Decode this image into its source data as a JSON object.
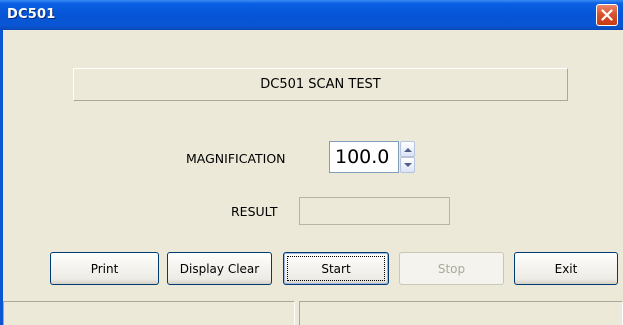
{
  "window": {
    "title": "DC501"
  },
  "banner": {
    "text": "DC501 SCAN TEST"
  },
  "magnification": {
    "label": "MAGNIFICATION",
    "value": "100.0"
  },
  "result": {
    "label": "RESULT",
    "value": ""
  },
  "buttons": {
    "print": "Print",
    "display_clear": "Display Clear",
    "start": "Start",
    "stop": "Stop",
    "exit": "Exit"
  },
  "status_bar": {
    "pane1": "",
    "pane2": ""
  },
  "colors": {
    "titlebar": "#0655d6",
    "window_bg": "#ece9d8",
    "close_button": "#d8542f",
    "disabled_text": "#aca899"
  },
  "icons": {
    "close": "close-icon",
    "spin_up": "chevron-up-icon",
    "spin_down": "chevron-down-icon"
  }
}
